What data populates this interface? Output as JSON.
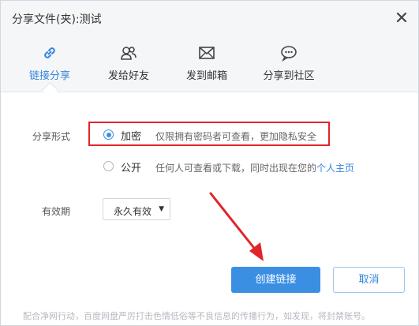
{
  "dialog": {
    "title": "分享文件(夹):测试"
  },
  "tabs": [
    {
      "label": "链接分享",
      "icon": "link-icon",
      "active": true
    },
    {
      "label": "发给好友",
      "icon": "friends-icon",
      "active": false
    },
    {
      "label": "发到邮箱",
      "icon": "mail-icon",
      "active": false
    },
    {
      "label": "分享到社区",
      "icon": "community-chat-icon",
      "active": false
    }
  ],
  "share_form": {
    "label": "分享形式",
    "options": [
      {
        "label": "加密",
        "desc": "仅限拥有密码者可查看，更加隐私安全",
        "checked": true
      },
      {
        "label": "公开",
        "desc": "任何人可查看或下载，同时出现在您的",
        "link": "个人主页",
        "checked": false
      }
    ]
  },
  "validity": {
    "label": "有效期",
    "selected": "永久有效"
  },
  "buttons": {
    "create": "创建链接",
    "cancel": "取消"
  },
  "footer_note": "配合净网行动，百度网盘严厉打击色情低俗等不良信息的传播行为，如发现，将封禁账号。",
  "colors": {
    "accent": "#3b8fe3",
    "annotation_red": "#e0252b"
  }
}
